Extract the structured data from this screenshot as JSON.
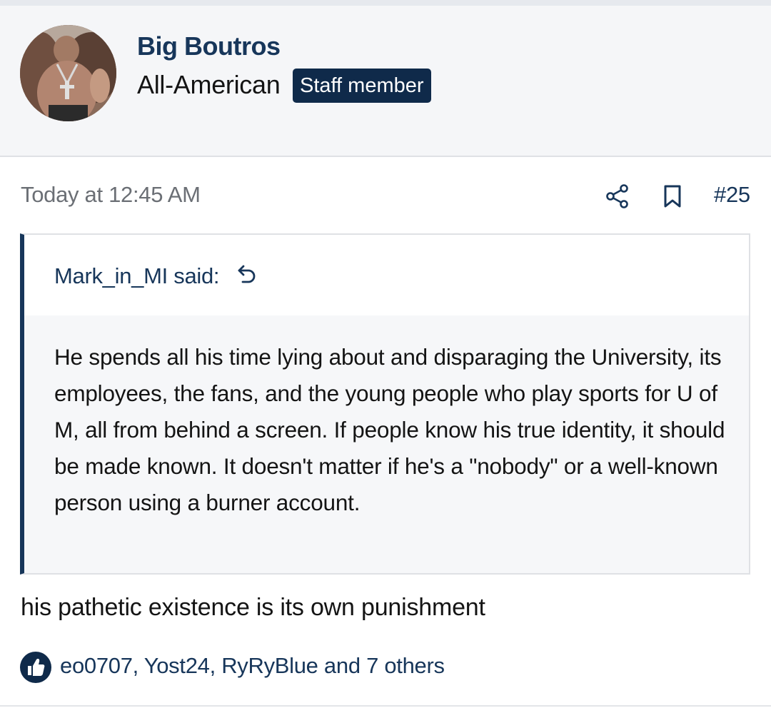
{
  "user": {
    "name": "Big Boutros",
    "title": "All-American",
    "badge": "Staff member",
    "avatar_icon": "user-avatar-photo"
  },
  "post": {
    "timestamp": "Today at 12:45 AM",
    "number": "#25",
    "body": "his pathetic existence is its own punishment"
  },
  "quote": {
    "author": "Mark_in_MI said:",
    "text": "He spends all his time lying about and disparaging the University, its employees, the fans, and the young people who play sports for U of M, all from behind a screen. If people know his true identity, it should be made known. It doesn't matter if he's a \"nobody\" or a well-known person using a burner account."
  },
  "reactions": {
    "text": "eo0707, Yost24, RyRyBlue and 7 others",
    "icon": "thumbs-up-icon"
  },
  "colors": {
    "accent": "#17365a",
    "badge_bg": "#0f2a4a",
    "header_bg": "#f5f6f8",
    "quote_bg": "#f6f7f9"
  },
  "icons": [
    "share-icon",
    "bookmark-icon",
    "reply-arrow-icon",
    "thumbs-up-icon"
  ]
}
